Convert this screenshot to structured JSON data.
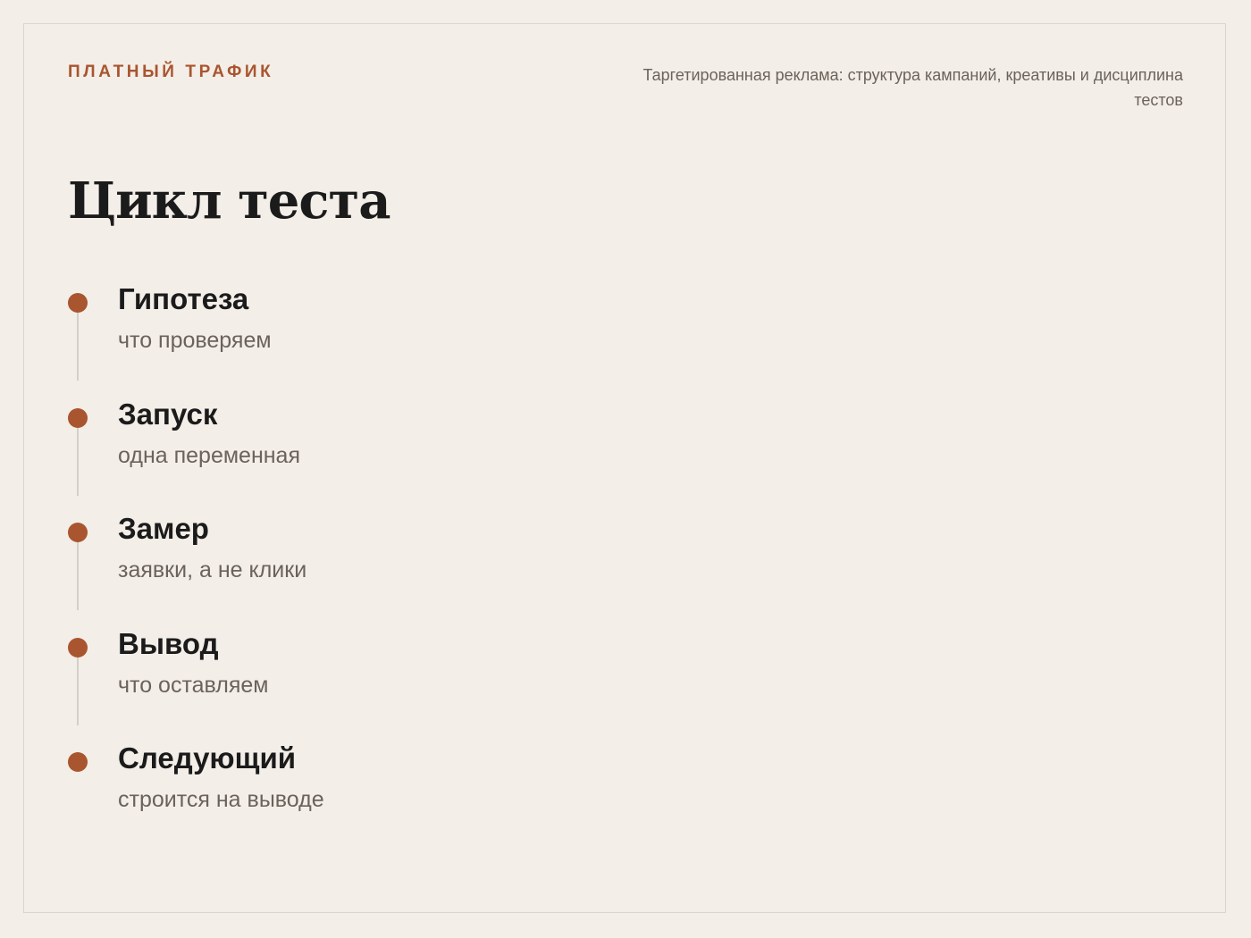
{
  "header": {
    "eyebrow": "ПЛАТНЫЙ ТРАФИК",
    "subtitle": "Таргетированная реклама: структура кампаний, креативы и дисциплина тестов"
  },
  "slide": {
    "title": "Цикл теста"
  },
  "steps": [
    {
      "title": "Гипотеза",
      "description": "что проверяем"
    },
    {
      "title": "Запуск",
      "description": "одна переменная"
    },
    {
      "title": "Замер",
      "description": "заявки, а не клики"
    },
    {
      "title": "Вывод",
      "description": "что оставляем"
    },
    {
      "title": "Следующий",
      "description": "строится на выводе"
    }
  ],
  "colors": {
    "background": "#f3eee8",
    "accent": "#a9552f",
    "heading": "#1b1b1b",
    "muted": "#6b625b",
    "connector": "#d3cfca"
  }
}
